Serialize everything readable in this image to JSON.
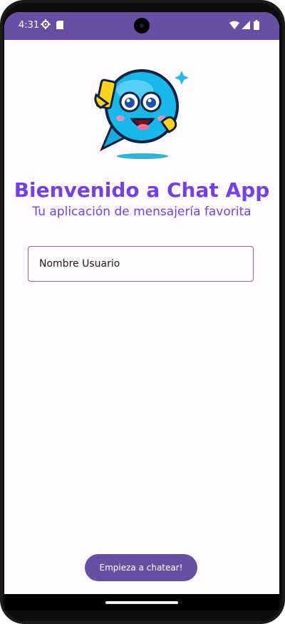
{
  "status_bar": {
    "time": "4:31",
    "icons": [
      "settings-gear-icon",
      "sd-card-icon",
      "wifi-icon",
      "signal-icon",
      "battery-icon"
    ]
  },
  "branding": {
    "logo": "chat-bubble-mascot-logo"
  },
  "welcome": {
    "title": "Bienvenido a Chat App",
    "subtitle": "Tu aplicación de mensajería favorita"
  },
  "form": {
    "username_placeholder": "Nombre Usuario"
  },
  "actions": {
    "start_label": "Empieza a chatear!"
  },
  "colors": {
    "primary": "#6750a4",
    "accent_text": "#7540e0",
    "background": "#fffbfe"
  }
}
